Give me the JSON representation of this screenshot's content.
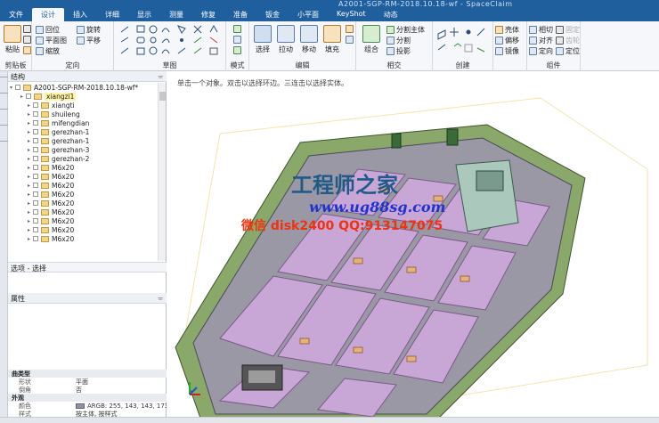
{
  "title_fragment": "A2001-SGP-RM-2018.10.18-wf - SpaceClaim",
  "tabs": [
    "文件",
    "设计",
    "插入",
    "详细",
    "显示",
    "测量",
    "修复",
    "准备",
    "钣金",
    "小平面",
    "KeyShot",
    "动态"
  ],
  "active_tab": "设计",
  "ribbon": {
    "clipboard": {
      "paste": "粘贴",
      "label": "剪贴板"
    },
    "orient": {
      "home": "回位",
      "plane": "平面图",
      "zoom": "缩放",
      "spin": "旋转",
      "pan": "平移",
      "label": "定向"
    },
    "sketch": {
      "label": "草图"
    },
    "mode": {
      "label": "模式"
    },
    "edit": {
      "select": "选择",
      "pull": "拉动",
      "move": "移动",
      "fill": "填充",
      "label": "编辑"
    },
    "intersect": {
      "combine": "组合",
      "split_body": "分割主体",
      "split": "分割",
      "project": "投影",
      "label": "相交"
    },
    "create": {
      "label": "创建"
    },
    "body": {
      "shell": "壳体",
      "offset": "偏移",
      "mirror": "镜像",
      "label": ""
    },
    "assembly": {
      "tangent": "相切",
      "align": "对齐",
      "orient": "定向",
      "anchor": "固定",
      "gear": "齿轮",
      "lock": "定位",
      "label": "组件"
    }
  },
  "left_strip": [
    "结构",
    "图层",
    "选择",
    "群组",
    "视图"
  ],
  "structure": {
    "title": "结构",
    "root": "A2001-SGP-RM-2018.10.18-wf*",
    "items": [
      {
        "label": "xiangzi1",
        "selected": true
      },
      {
        "label": "xiangti",
        "selected": false
      },
      {
        "label": "shuileng",
        "selected": false
      },
      {
        "label": "mifengdian",
        "selected": false
      },
      {
        "label": "gerezhan-1",
        "selected": false
      },
      {
        "label": "gerezhan-1",
        "selected": false
      },
      {
        "label": "gerezhan-3",
        "selected": false
      },
      {
        "label": "gerezhan-2",
        "selected": false
      },
      {
        "label": "M6x20",
        "selected": false
      },
      {
        "label": "M6x20",
        "selected": false
      },
      {
        "label": "M6x20",
        "selected": false
      },
      {
        "label": "M6x20",
        "selected": false
      },
      {
        "label": "M6x20",
        "selected": false
      },
      {
        "label": "M6x20",
        "selected": false
      },
      {
        "label": "M6x20",
        "selected": false
      },
      {
        "label": "M6x20",
        "selected": false
      },
      {
        "label": "M6x20",
        "selected": false
      }
    ]
  },
  "selection_panel": "选项 - 选择",
  "properties": {
    "title": "属性",
    "rows": [
      {
        "key": "曲类型",
        "value": "",
        "section": true
      },
      {
        "key": "形状",
        "value": "平面",
        "section": false
      },
      {
        "key": "倒角",
        "value": "否",
        "section": false
      },
      {
        "key": "外观",
        "value": "",
        "section": true
      },
      {
        "key": "颜色",
        "value": "ARGB: 255, 143, 143, 173",
        "section": false,
        "swatch": "#8f8fad"
      },
      {
        "key": "样式",
        "value": "按主体, 按样式",
        "section": false
      }
    ]
  },
  "viewport": {
    "hint": "单击一个对象。双击以选择环边。三连击以选择实体。",
    "watermark_cn": "工程师之家",
    "watermark_url": "www.ug88sg.com",
    "watermark_contact": "微信 disk2400 QQ:913147075"
  },
  "colors": {
    "accent": "#1f5f9e",
    "part_pink": "#c8a6d6",
    "frame_green": "#8aa86a"
  }
}
